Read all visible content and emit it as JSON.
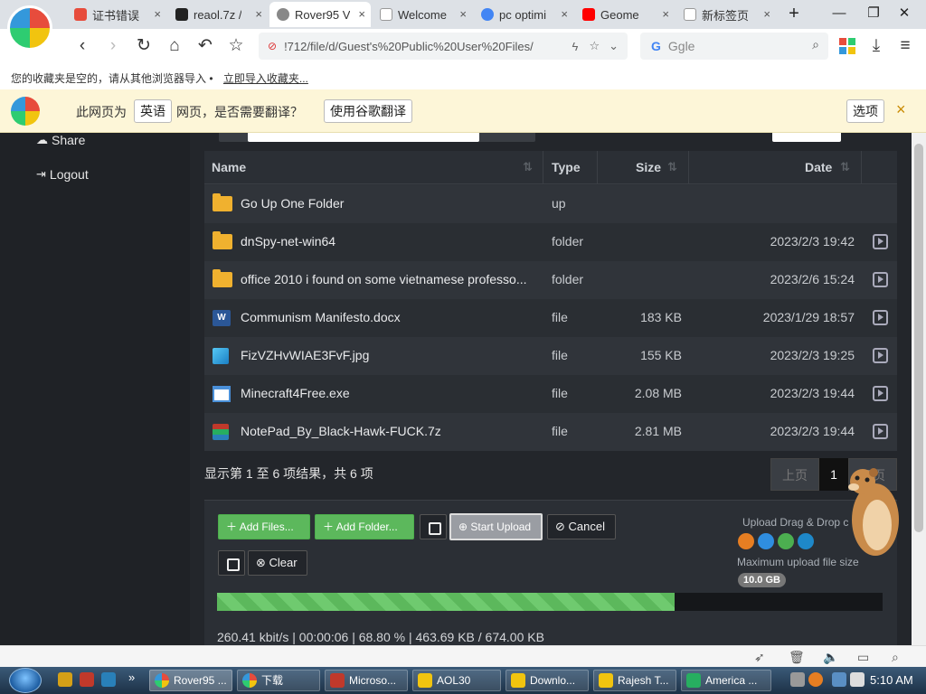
{
  "tabs": [
    {
      "label": "证书错误",
      "color": "#e74c3c"
    },
    {
      "label": "reaol.7z / ",
      "color": "#222222"
    },
    {
      "label": "Rover95 V",
      "color": "#888888"
    },
    {
      "label": "Welcome",
      "color": "#999999"
    },
    {
      "label": "pc optimi",
      "color": "#4285f4"
    },
    {
      "label": "Geome",
      "color": "#ff0000"
    },
    {
      "label": "新标签页",
      "color": "#bbbbbb"
    }
  ],
  "address": {
    "url": "!712/file/d/Guest's%20Public%20User%20Files/",
    "search_placeholder": "Ggle",
    "search_brand": "G"
  },
  "bookmarks": {
    "empty_text": "您的收藏夹是空的，请从其他浏览器导入 •",
    "import_link": "立即导入收藏夹..."
  },
  "translate": {
    "prefix": "此网页为",
    "language": "英语",
    "question": "网页，是否需要翻译？",
    "translate_button": "使用谷歌翻译",
    "options_button": "选项",
    "close": "×"
  },
  "sidebar": [
    {
      "label": "Share",
      "icon": "cloud-icon"
    },
    {
      "label": "Logout",
      "icon": "logout-icon"
    }
  ],
  "table": {
    "headers": {
      "name": "Name",
      "type": "Type",
      "size": "Size",
      "date": "Date"
    },
    "rows": [
      {
        "name": "Go Up One Folder",
        "type": "up",
        "size": "",
        "date": "",
        "icon": "folder-icon",
        "action": false
      },
      {
        "name": "dnSpy-net-win64",
        "type": "folder",
        "size": "",
        "date": "2023/2/3 19:42",
        "icon": "folder-icon",
        "action": true
      },
      {
        "name": "office 2010 i found on some vietnamese professo...",
        "type": "folder",
        "size": "",
        "date": "2023/2/6 15:24",
        "icon": "folder-icon",
        "action": true
      },
      {
        "name": "Communism Manifesto.docx",
        "type": "file",
        "size": "183 KB",
        "date": "2023/1/29 18:57",
        "icon": "word-icon",
        "action": true
      },
      {
        "name": "FizVZHvWIAE3FvF.jpg",
        "type": "file",
        "size": "155 KB",
        "date": "2023/2/3 19:25",
        "icon": "image-icon",
        "action": true
      },
      {
        "name": "Minecraft4Free.exe",
        "type": "file",
        "size": "2.08 MB",
        "date": "2023/2/3 19:44",
        "icon": "exe-icon",
        "action": true
      },
      {
        "name": "NotePad_By_Black-Hawk-FUCK.7z",
        "type": "file",
        "size": "2.81 MB",
        "date": "2023/2/3 19:44",
        "icon": "archive-icon",
        "action": true
      }
    ]
  },
  "pagination": {
    "info": "显示第 1 至 6 项结果，共 6 项",
    "prev": "上页",
    "current": "1",
    "next": "下页"
  },
  "upload": {
    "add_files": "Add Files...",
    "add_folder": "Add Folder...",
    "start_upload": "Start Upload",
    "cancel": "Cancel",
    "clear": "Clear",
    "dragdrop": "Upload Drag & Drop c",
    "max_label": "Maximum upload file size",
    "max_value": "10.0 GB",
    "progress_fraction": 0.688,
    "stats": "260.41 kbit/s | 00:00:06 | 68.80 % | 463.69 KB / 674.00 KB"
  },
  "taskbar": {
    "items": [
      {
        "label": "Rover95 ...",
        "color": "#e67e22"
      },
      {
        "label": "下载",
        "color": "#e67e22"
      },
      {
        "label": "Microso...",
        "color": "#c0392b"
      },
      {
        "label": "AOL30",
        "color": "#f1c40f"
      },
      {
        "label": "Downlo...",
        "color": "#f1c40f"
      },
      {
        "label": "Rajesh T...",
        "color": "#f1c40f"
      },
      {
        "label": "America ...",
        "color": "#27ae60"
      }
    ],
    "clock": "5:10 AM"
  }
}
